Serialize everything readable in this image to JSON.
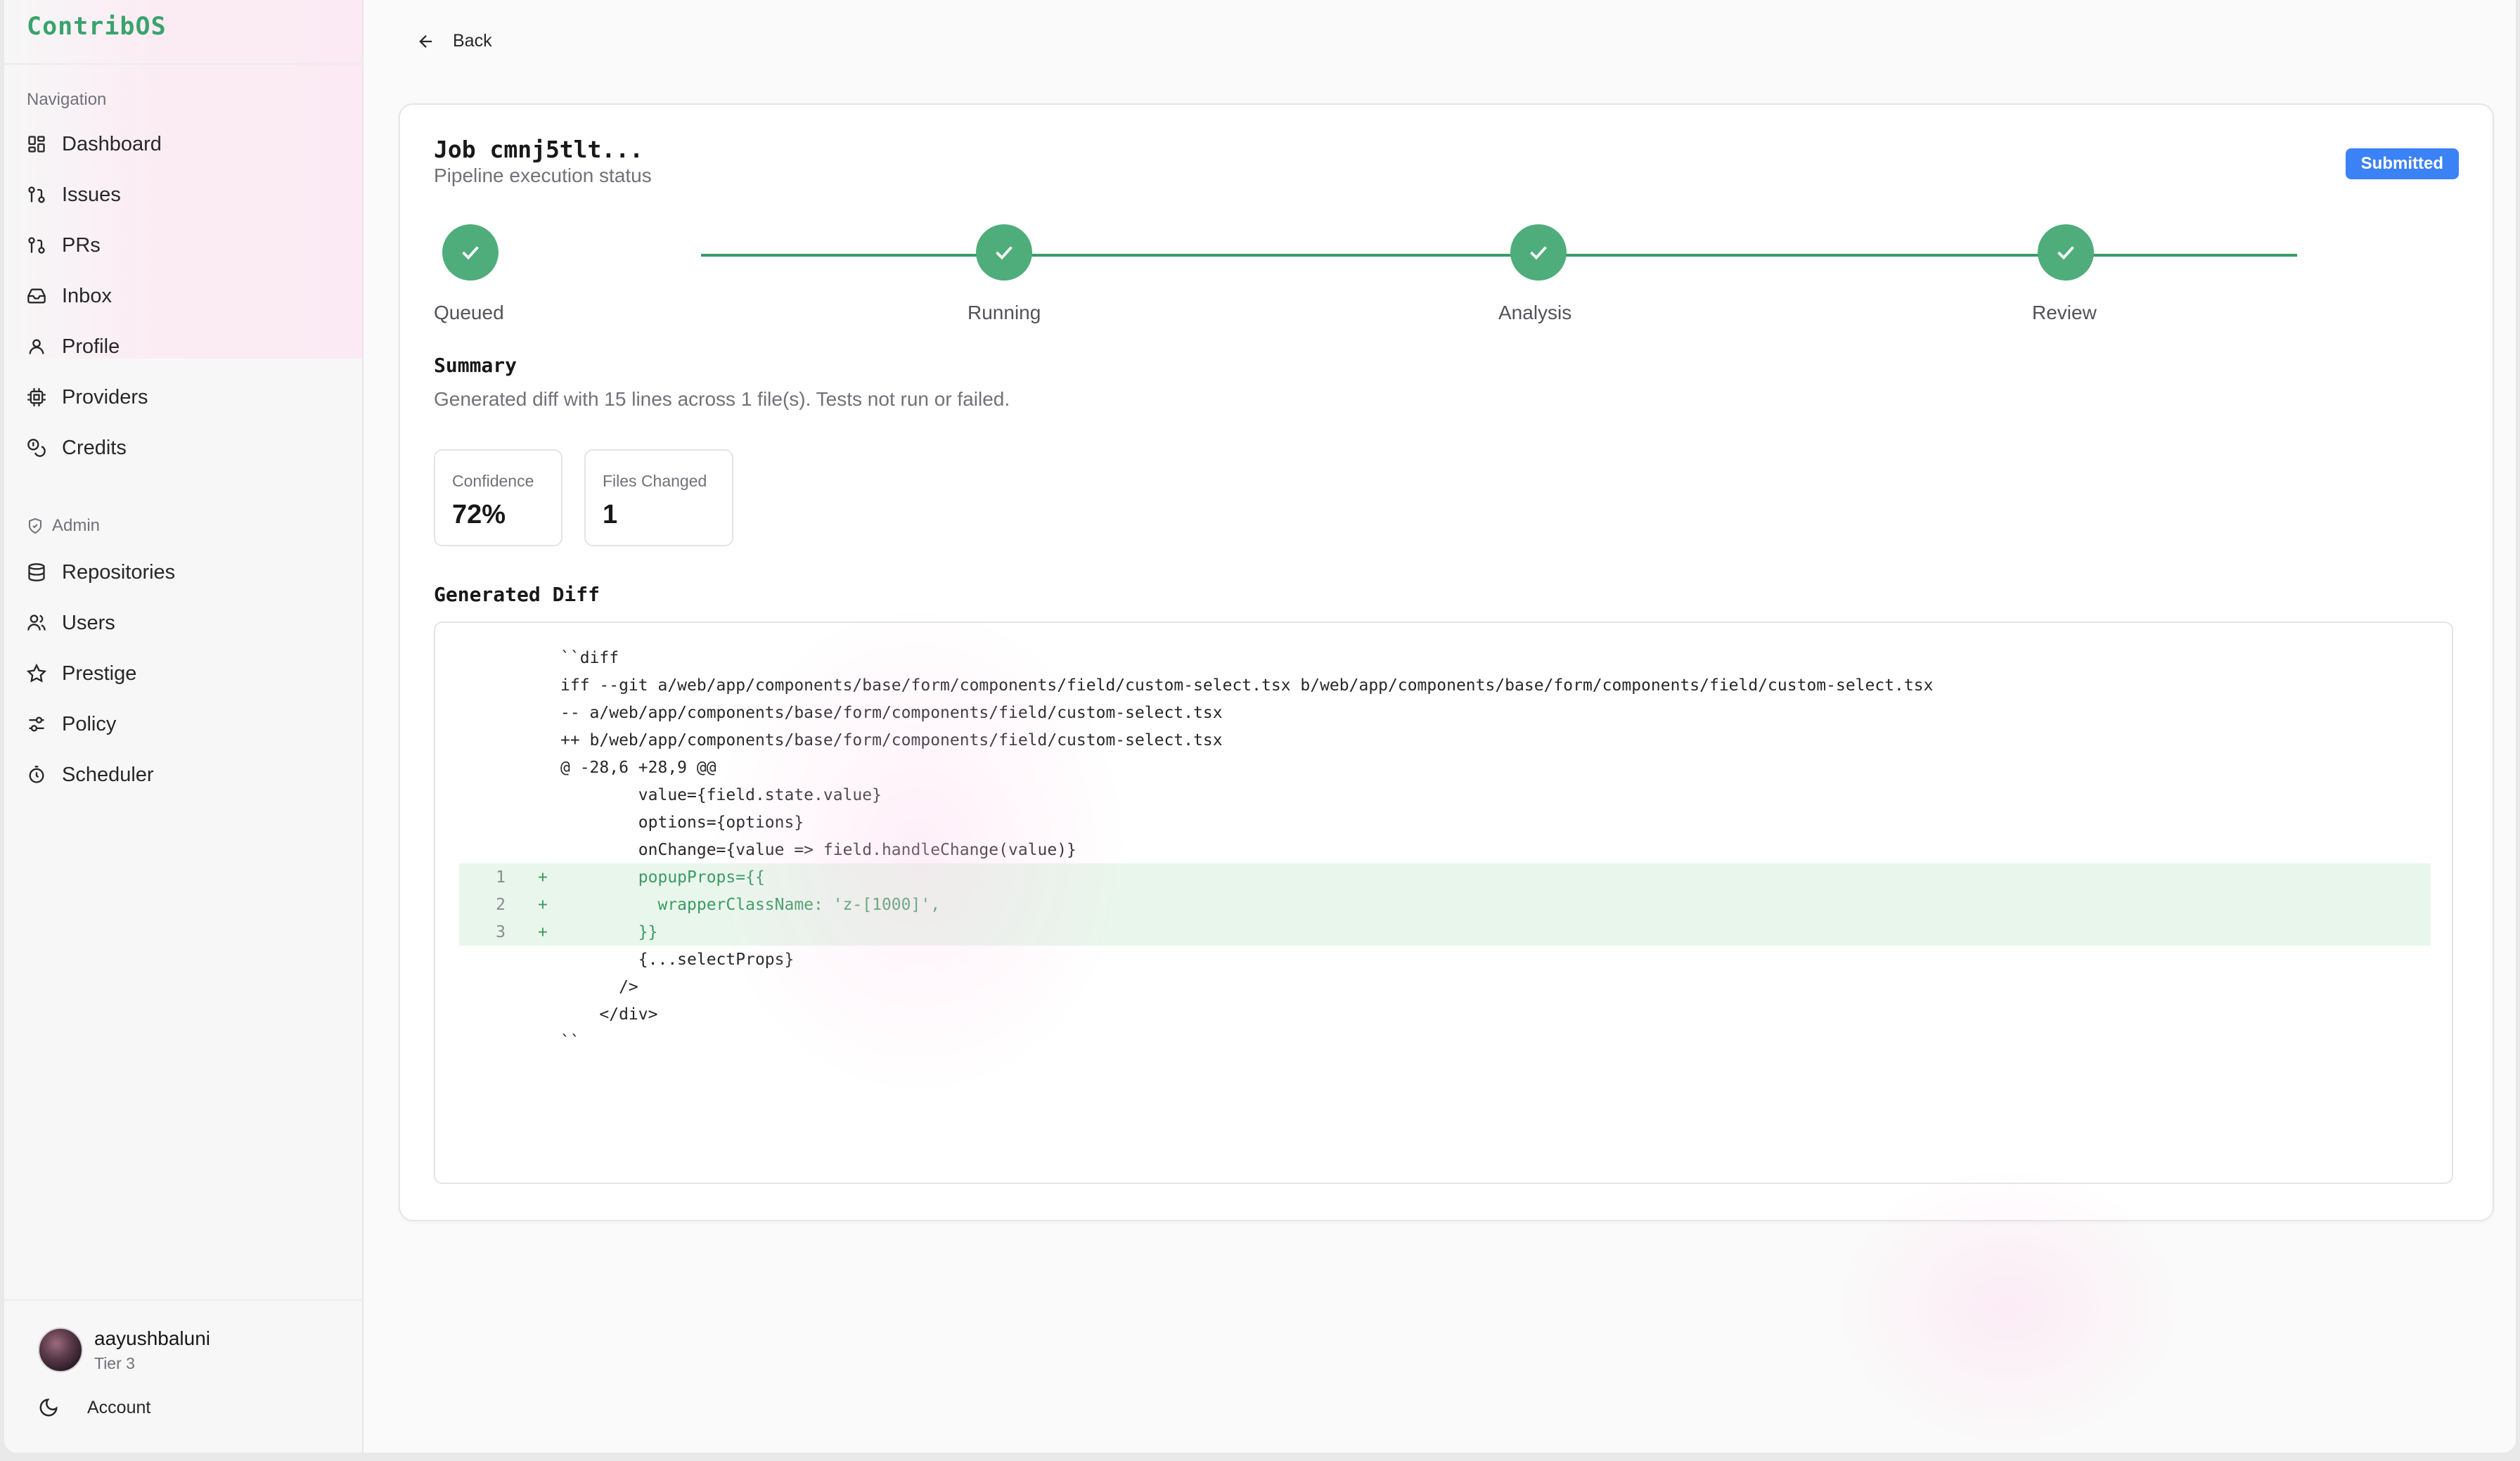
{
  "app": {
    "brand": "ContribOS"
  },
  "sidebar": {
    "nav_section_label": "Navigation",
    "nav_items": [
      {
        "label": "Dashboard",
        "icon": "dashboard-icon"
      },
      {
        "label": "Issues",
        "icon": "issues-icon"
      },
      {
        "label": "PRs",
        "icon": "pull-request-icon"
      },
      {
        "label": "Inbox",
        "icon": "inbox-icon"
      },
      {
        "label": "Profile",
        "icon": "user-icon"
      },
      {
        "label": "Providers",
        "icon": "chip-icon"
      },
      {
        "label": "Credits",
        "icon": "coins-icon"
      }
    ],
    "admin_section_label": "Admin",
    "admin_items": [
      {
        "label": "Repositories",
        "icon": "database-icon"
      },
      {
        "label": "Users",
        "icon": "users-icon"
      },
      {
        "label": "Prestige",
        "icon": "star-icon"
      },
      {
        "label": "Policy",
        "icon": "sliders-icon"
      },
      {
        "label": "Scheduler",
        "icon": "timer-icon"
      }
    ],
    "user": {
      "name": "aayushbaluni",
      "tier": "Tier 3"
    },
    "account_label": "Account"
  },
  "main": {
    "back_label": "Back",
    "job": {
      "title": "Job cmnj5tlt...",
      "subtitle": "Pipeline execution status",
      "status": "Submitted",
      "status_color": "#3b82f6"
    },
    "steps": [
      {
        "label": "Queued",
        "state": "done"
      },
      {
        "label": "Running",
        "state": "done"
      },
      {
        "label": "Analysis",
        "state": "done"
      },
      {
        "label": "Review",
        "state": "done"
      }
    ],
    "summary": {
      "title": "Summary",
      "text": "Generated diff with 15 lines across 1 file(s). Tests not run or failed."
    },
    "stats": [
      {
        "label": "Confidence",
        "value": "72%"
      },
      {
        "label": "Files Changed",
        "value": "1"
      }
    ],
    "diff": {
      "title": "Generated Diff",
      "lines": [
        {
          "ln": "",
          "mark": "",
          "code": "``diff",
          "added": false
        },
        {
          "ln": "",
          "mark": "",
          "code": "iff --git a/web/app/components/base/form/components/field/custom-select.tsx b/web/app/components/base/form/components/field/custom-select.tsx",
          "added": false
        },
        {
          "ln": "",
          "mark": "",
          "code": "-- a/web/app/components/base/form/components/field/custom-select.tsx",
          "added": false
        },
        {
          "ln": "",
          "mark": "",
          "code": "++ b/web/app/components/base/form/components/field/custom-select.tsx",
          "added": false
        },
        {
          "ln": "",
          "mark": "",
          "code": "@ -28,6 +28,9 @@",
          "added": false
        },
        {
          "ln": "",
          "mark": "",
          "code": "        value={field.state.value}",
          "added": false
        },
        {
          "ln": "",
          "mark": "",
          "code": "        options={options}",
          "added": false
        },
        {
          "ln": "",
          "mark": "",
          "code": "        onChange={value => field.handleChange(value)}",
          "added": false
        },
        {
          "ln": "1",
          "mark": "+",
          "code": "        popupProps={{",
          "added": true
        },
        {
          "ln": "2",
          "mark": "+",
          "code": "          wrapperClassName: 'z-[1000]',",
          "added": true
        },
        {
          "ln": "3",
          "mark": "+",
          "code": "        }}",
          "added": true
        },
        {
          "ln": "",
          "mark": "",
          "code": "        {...selectProps}",
          "added": false
        },
        {
          "ln": "",
          "mark": "",
          "code": "      />",
          "added": false
        },
        {
          "ln": "",
          "mark": "",
          "code": "    </div>",
          "added": false
        },
        {
          "ln": "",
          "mark": "",
          "code": "``",
          "added": false
        }
      ]
    }
  }
}
